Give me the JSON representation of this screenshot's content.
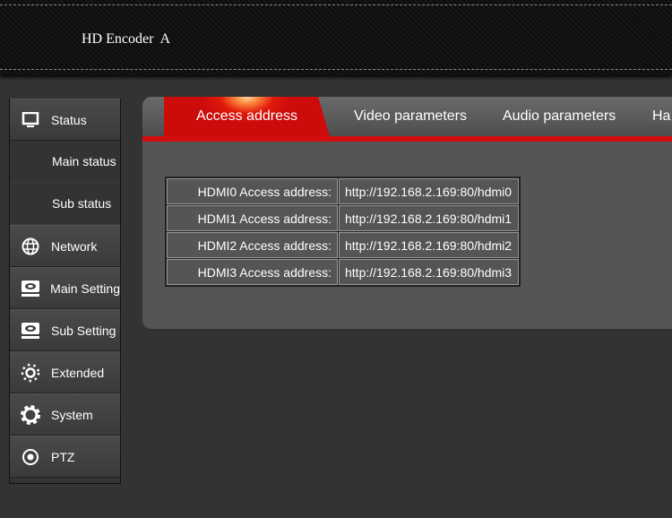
{
  "header": {
    "title": "HD Encoder  A"
  },
  "sidebar": {
    "status": "Status",
    "main_status": "Main status",
    "sub_status": "Sub status",
    "items": [
      {
        "label": "Network"
      },
      {
        "label": "Main Setting"
      },
      {
        "label": "Sub Setting"
      },
      {
        "label": "Extended"
      },
      {
        "label": "System"
      },
      {
        "label": "PTZ"
      }
    ]
  },
  "tabs": [
    "Access address",
    "Video parameters",
    "Audio parameters",
    "Ha"
  ],
  "accent": "#d20d0d",
  "table": [
    {
      "label": "HDMI0 Access address:",
      "value": "http://192.168.2.169:80/hdmi0"
    },
    {
      "label": "HDMI1 Access address:",
      "value": "http://192.168.2.169:80/hdmi1"
    },
    {
      "label": "HDMI2 Access address:",
      "value": "http://192.168.2.169:80/hdmi2"
    },
    {
      "label": "HDMI3 Access address:",
      "value": "http://192.168.2.169:80/hdmi3"
    }
  ]
}
